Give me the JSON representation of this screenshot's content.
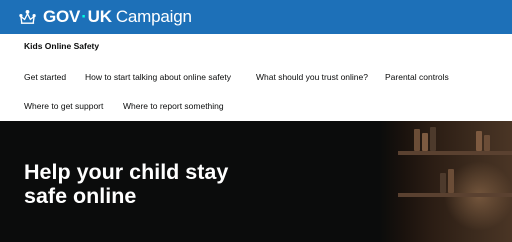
{
  "header": {
    "logo_text": "GOV",
    "logo_separator": "·",
    "logo_text2": "UK",
    "logo_suffix": "Campaign",
    "brand_color": "#1d70b8",
    "icon": "crown-icon"
  },
  "service": {
    "name": "Kids Online Safety"
  },
  "nav": {
    "items": [
      "Get started",
      "How to start talking about online safety",
      "What should you trust online?",
      "Parental controls",
      "Where to get support",
      "Where to report something"
    ]
  },
  "hero": {
    "title": "Help your child stay safe online",
    "background_color": "#0b0c0c"
  }
}
